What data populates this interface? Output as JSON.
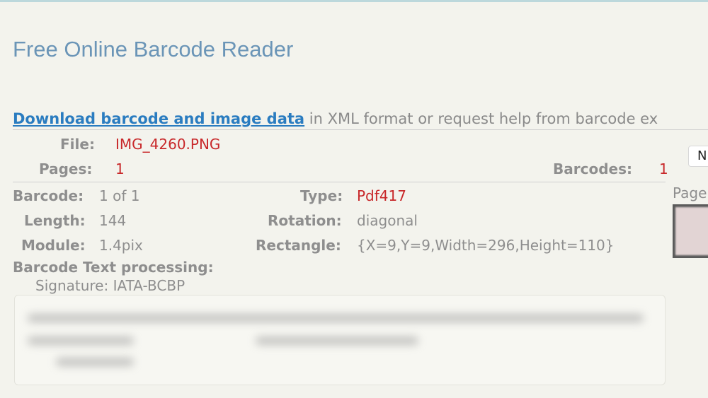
{
  "page": {
    "title": "Free Online Barcode Reader"
  },
  "download": {
    "link_text": "Download barcode and image data",
    "rest_text": " in XML format or request help from barcode ex"
  },
  "file_info": {
    "file_label": "File:",
    "file_value": "IMG_4260.PNG",
    "pages_label": "Pages:",
    "pages_value": "1",
    "barcodes_label": "Barcodes:",
    "barcodes_value": "1",
    "nav_button": "N"
  },
  "barcode": {
    "barcode_label": "Barcode:",
    "barcode_value": "1 of 1",
    "type_label": "Type:",
    "type_value": "Pdf417",
    "length_label": "Length:",
    "length_value": "144",
    "rotation_label": "Rotation:",
    "rotation_value": "diagonal",
    "module_label": "Module:",
    "module_value": "1.4pix",
    "rectangle_label": "Rectangle:",
    "rectangle_value": "{X=9,Y=9,Width=296,Height=110}",
    "processing_label": "Barcode Text processing:",
    "signature": "Signature: IATA-BCBP"
  },
  "preview": {
    "page_label": "Page"
  },
  "colors": {
    "title": "#6b95b7",
    "link": "#2a7cc0",
    "value_red": "#c8282a",
    "background": "#f3f3ed"
  }
}
